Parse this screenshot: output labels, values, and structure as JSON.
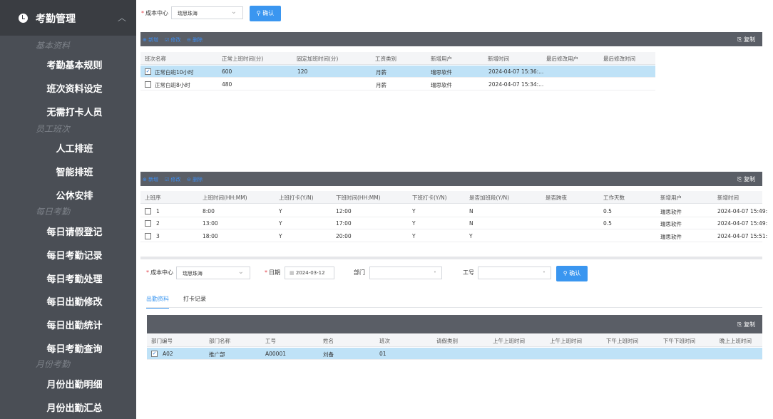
{
  "sidebar": {
    "title": "考勤管理",
    "sections": [
      {
        "label": "基本资料",
        "items": [
          "考勤基本规则",
          "班次资料设定",
          "无需打卡人员"
        ]
      },
      {
        "label": "员工班次",
        "items": [
          "人工排班",
          "智能排班",
          "公休安排"
        ]
      },
      {
        "label": "每日考勤",
        "items": [
          "每日请假登记",
          "每日考勤记录",
          "每日考勤处理",
          "每日出勤修改",
          "每日出勤统计",
          "每日考勤查询"
        ]
      },
      {
        "label": "月份考勤",
        "items": [
          "月份出勤明细",
          "月份出勤汇总"
        ]
      }
    ]
  },
  "top_filter": {
    "cost_center_label": "成本中心",
    "cost_center_value": "瑞思珠海",
    "confirm_label": "确认"
  },
  "toolbar1": {
    "add": "新增",
    "edit": "修改",
    "delete": "删除",
    "copy": "复制"
  },
  "shift_table": {
    "columns": [
      "班次名称",
      "正常上班时间(分)",
      "固定加班时间(分)",
      "工资类别",
      "新增用户",
      "新增时间",
      "最后修改用户",
      "最后修改时间"
    ],
    "rows": [
      {
        "checked": true,
        "cells": [
          "正常白班10小时",
          "600",
          "120",
          "月薪",
          "瑞思软件",
          "2024-04-07 15:36:...",
          "",
          ""
        ]
      },
      {
        "checked": false,
        "cells": [
          "正常白班8小时",
          "480",
          "",
          "月薪",
          "瑞思软件",
          "2024-04-07 15:34:...",
          "",
          ""
        ]
      }
    ]
  },
  "toolbar2": {
    "add": "新增",
    "edit": "修改",
    "delete": "删除",
    "copy": "复制"
  },
  "period_table": {
    "columns": [
      "上班序",
      "上班时间(HH:MM)",
      "上班打卡(Y/N)",
      "下班时间(HH:MM)",
      "下班打卡(Y/N)",
      "是否加班段(Y/N)",
      "是否跨夜",
      "工作天数",
      "新增用户",
      "新增时间"
    ],
    "rows": [
      {
        "cells": [
          "1",
          "8:00",
          "Y",
          "12:00",
          "Y",
          "N",
          "",
          "0.5",
          "瑞思软件",
          "2024-04-07 15:49:"
        ]
      },
      {
        "cells": [
          "2",
          "13:00",
          "Y",
          "17:00",
          "Y",
          "N",
          "",
          "0.5",
          "瑞思软件",
          "2024-04-07 15:49:"
        ]
      },
      {
        "cells": [
          "3",
          "18:00",
          "Y",
          "20:00",
          "Y",
          "Y",
          "",
          "",
          "瑞思软件",
          "2024-04-07 15:51:"
        ]
      }
    ]
  },
  "bottom_filter": {
    "cost_center_label": "成本中心",
    "cost_center_value": "瑞思珠海",
    "date_label": "日期",
    "date_value": "2024-03-12",
    "dept_label": "部门",
    "dept_value": "",
    "empno_label": "工号",
    "empno_value": "",
    "confirm_label": "确认"
  },
  "tabs": {
    "attendance": "出勤资料",
    "punch": "打卡记录"
  },
  "toolbar3": {
    "copy": "复制"
  },
  "attendance_table": {
    "columns": [
      "部门编号",
      "部门名称",
      "工号",
      "姓名",
      "班次",
      "请假类别",
      "上午上班时间",
      "上午上班时间",
      "下午上班时间",
      "下午下班时间",
      "晚上上班时间"
    ],
    "rows": [
      {
        "checked": true,
        "cells": [
          "A02",
          "推广部",
          "A00001",
          "刘备",
          "01",
          "",
          "",
          "",
          "",
          "",
          ""
        ]
      }
    ]
  }
}
